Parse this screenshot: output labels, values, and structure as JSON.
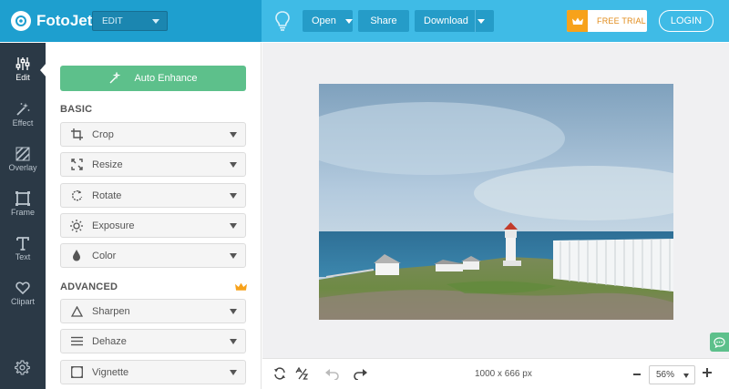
{
  "header": {
    "brand": "FotoJet",
    "mode_select": "EDIT",
    "buttons": {
      "open": "Open",
      "share": "Share",
      "download": "Download"
    },
    "free_trial": "FREE TRIAL",
    "login": "LOGIN"
  },
  "rail": {
    "items": [
      {
        "label": "Edit",
        "icon": "sliders-icon"
      },
      {
        "label": "Effect",
        "icon": "magic-wand-icon"
      },
      {
        "label": "Overlay",
        "icon": "stripes-icon"
      },
      {
        "label": "Frame",
        "icon": "frame-icon"
      },
      {
        "label": "Text",
        "icon": "text-icon"
      },
      {
        "label": "Clipart",
        "icon": "heart-icon"
      }
    ],
    "settings_icon": "gear-icon"
  },
  "panel": {
    "auto_enhance": "Auto Enhance",
    "basic_title": "BASIC",
    "basic": [
      {
        "label": "Crop",
        "icon": "crop-icon"
      },
      {
        "label": "Resize",
        "icon": "resize-icon"
      },
      {
        "label": "Rotate",
        "icon": "rotate-icon"
      },
      {
        "label": "Exposure",
        "icon": "exposure-icon"
      },
      {
        "label": "Color",
        "icon": "droplet-icon"
      }
    ],
    "advanced_title": "ADVANCED",
    "advanced": [
      {
        "label": "Sharpen",
        "icon": "triangle-icon"
      },
      {
        "label": "Dehaze",
        "icon": "lines-icon"
      },
      {
        "label": "Vignette",
        "icon": "vignette-icon"
      }
    ]
  },
  "canvas": {
    "dimensions": "1000 x 666 px",
    "zoom": "56%"
  },
  "colors": {
    "header_left": "#1e9fcf",
    "header_right": "#3fbbe6",
    "rail": "#2b3946",
    "accent_green": "#5dc08b",
    "trial_orange": "#f7a21b"
  }
}
